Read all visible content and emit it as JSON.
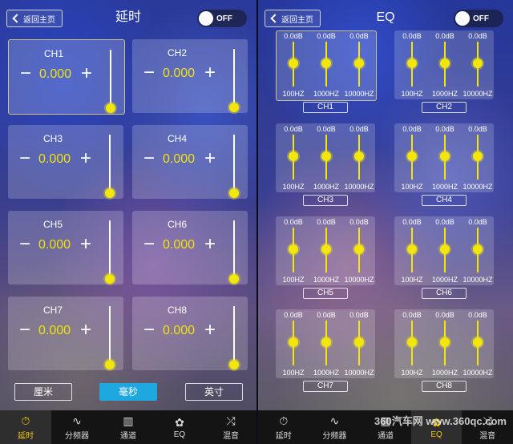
{
  "delay_screen": {
    "back_label": "返回主页",
    "title": "延时",
    "toggle_label": "OFF",
    "channels": [
      {
        "label": "CH1",
        "value": "0.000"
      },
      {
        "label": "CH2",
        "value": "0.000"
      },
      {
        "label": "CH3",
        "value": "0.000"
      },
      {
        "label": "CH4",
        "value": "0.000"
      },
      {
        "label": "CH5",
        "value": "0.000"
      },
      {
        "label": "CH6",
        "value": "0.000"
      },
      {
        "label": "CH7",
        "value": "0.000"
      },
      {
        "label": "CH8",
        "value": "0.000"
      }
    ],
    "minus_symbol": "−",
    "plus_symbol": "+",
    "units": [
      "厘米",
      "毫秒",
      "英寸"
    ],
    "active_unit": "毫秒"
  },
  "eq_screen": {
    "back_label": "返回主页",
    "title": "EQ",
    "toggle_label": "OFF",
    "groups": [
      {
        "label": "CH1",
        "bands": [
          {
            "db": "0.0dB",
            "freq": "100HZ"
          },
          {
            "db": "0.0dB",
            "freq": "1000HZ"
          },
          {
            "db": "0.0dB",
            "freq": "10000HZ"
          }
        ]
      },
      {
        "label": "CH2",
        "bands": [
          {
            "db": "0.0dB",
            "freq": "100HZ"
          },
          {
            "db": "0.0dB",
            "freq": "1000HZ"
          },
          {
            "db": "0.0dB",
            "freq": "10000HZ"
          }
        ]
      },
      {
        "label": "CH3",
        "bands": [
          {
            "db": "0.0dB",
            "freq": "100HZ"
          },
          {
            "db": "0.0dB",
            "freq": "1000HZ"
          },
          {
            "db": "0.0dB",
            "freq": "10000HZ"
          }
        ]
      },
      {
        "label": "CH4",
        "bands": [
          {
            "db": "0.0dB",
            "freq": "100HZ"
          },
          {
            "db": "0.0dB",
            "freq": "1000HZ"
          },
          {
            "db": "0.0dB",
            "freq": "10000HZ"
          }
        ]
      },
      {
        "label": "CH5",
        "bands": [
          {
            "db": "0.0dB",
            "freq": "100HZ"
          },
          {
            "db": "0.0dB",
            "freq": "1000HZ"
          },
          {
            "db": "0.0dB",
            "freq": "10000HZ"
          }
        ]
      },
      {
        "label": "CH6",
        "bands": [
          {
            "db": "0.0dB",
            "freq": "100HZ"
          },
          {
            "db": "0.0dB",
            "freq": "1000HZ"
          },
          {
            "db": "0.0dB",
            "freq": "10000HZ"
          }
        ]
      },
      {
        "label": "CH7",
        "bands": [
          {
            "db": "0.0dB",
            "freq": "100HZ"
          },
          {
            "db": "0.0dB",
            "freq": "1000HZ"
          },
          {
            "db": "0.0dB",
            "freq": "10000HZ"
          }
        ]
      },
      {
        "label": "CH8",
        "bands": [
          {
            "db": "0.0dB",
            "freq": "100HZ"
          },
          {
            "db": "0.0dB",
            "freq": "1000HZ"
          },
          {
            "db": "0.0dB",
            "freq": "10000HZ"
          }
        ]
      }
    ]
  },
  "nav": {
    "items": [
      {
        "label": "延时",
        "icon": "stopwatch-icon"
      },
      {
        "label": "分频器",
        "icon": "waveform-icon"
      },
      {
        "label": "通道",
        "icon": "mixer-icon"
      },
      {
        "label": "EQ",
        "icon": "eq-icon"
      },
      {
        "label": "混音",
        "icon": "shuffle-icon"
      }
    ],
    "left_active": "延时",
    "right_active": "EQ"
  },
  "watermark": "360汽车网 www.360qc.com",
  "colors": {
    "value_yellow": "#f1e30a",
    "active_unit": "#1fa7e0",
    "nav_bg": "#141414",
    "active_nav_text": "#f1c40f"
  }
}
